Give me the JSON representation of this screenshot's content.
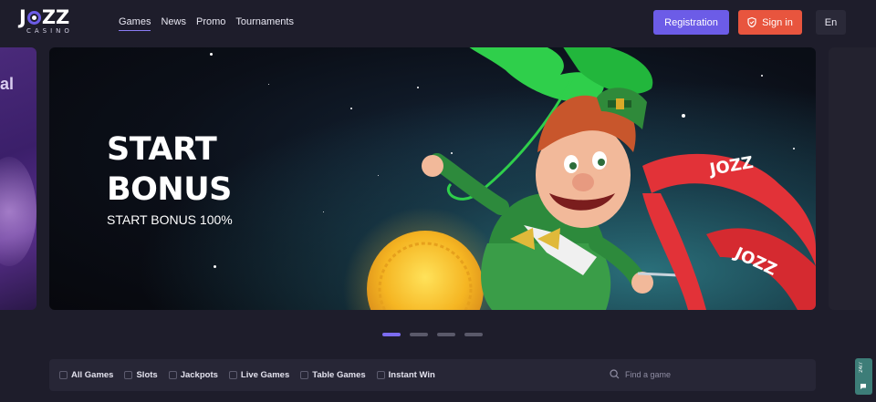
{
  "brand": {
    "name_left": "J",
    "name_right": "ZZ",
    "sub": "CASINO"
  },
  "nav": [
    {
      "label": "Games",
      "active": true
    },
    {
      "label": "News"
    },
    {
      "label": "Promo"
    },
    {
      "label": "Tournaments"
    }
  ],
  "header": {
    "register_label": "Registration",
    "signin_label": "Sign in",
    "lang_label": "En"
  },
  "carousel": {
    "left_fragment": "al",
    "title_line1": "START",
    "title_line2": "BONUS",
    "subtitle": "START BONUS 100%",
    "ribbon_text": "JOZZ",
    "slides_count": 4,
    "active_slide": 1
  },
  "categories": [
    {
      "label": "All Games",
      "icon": "grid-icon"
    },
    {
      "label": "Slots",
      "icon": "slots-icon"
    },
    {
      "label": "Jackpots",
      "icon": "jackpot-icon"
    },
    {
      "label": "Live Games",
      "icon": "live-icon"
    },
    {
      "label": "Table Games",
      "icon": "table-icon"
    },
    {
      "label": "Instant Win",
      "icon": "instant-icon"
    }
  ],
  "search": {
    "placeholder": "Find a game"
  },
  "support": {
    "label": "24/7"
  },
  "colors": {
    "accent": "#6c5ce7",
    "signin": "#e8553e",
    "background": "#1e1d2b",
    "support": "#3d7d78"
  }
}
